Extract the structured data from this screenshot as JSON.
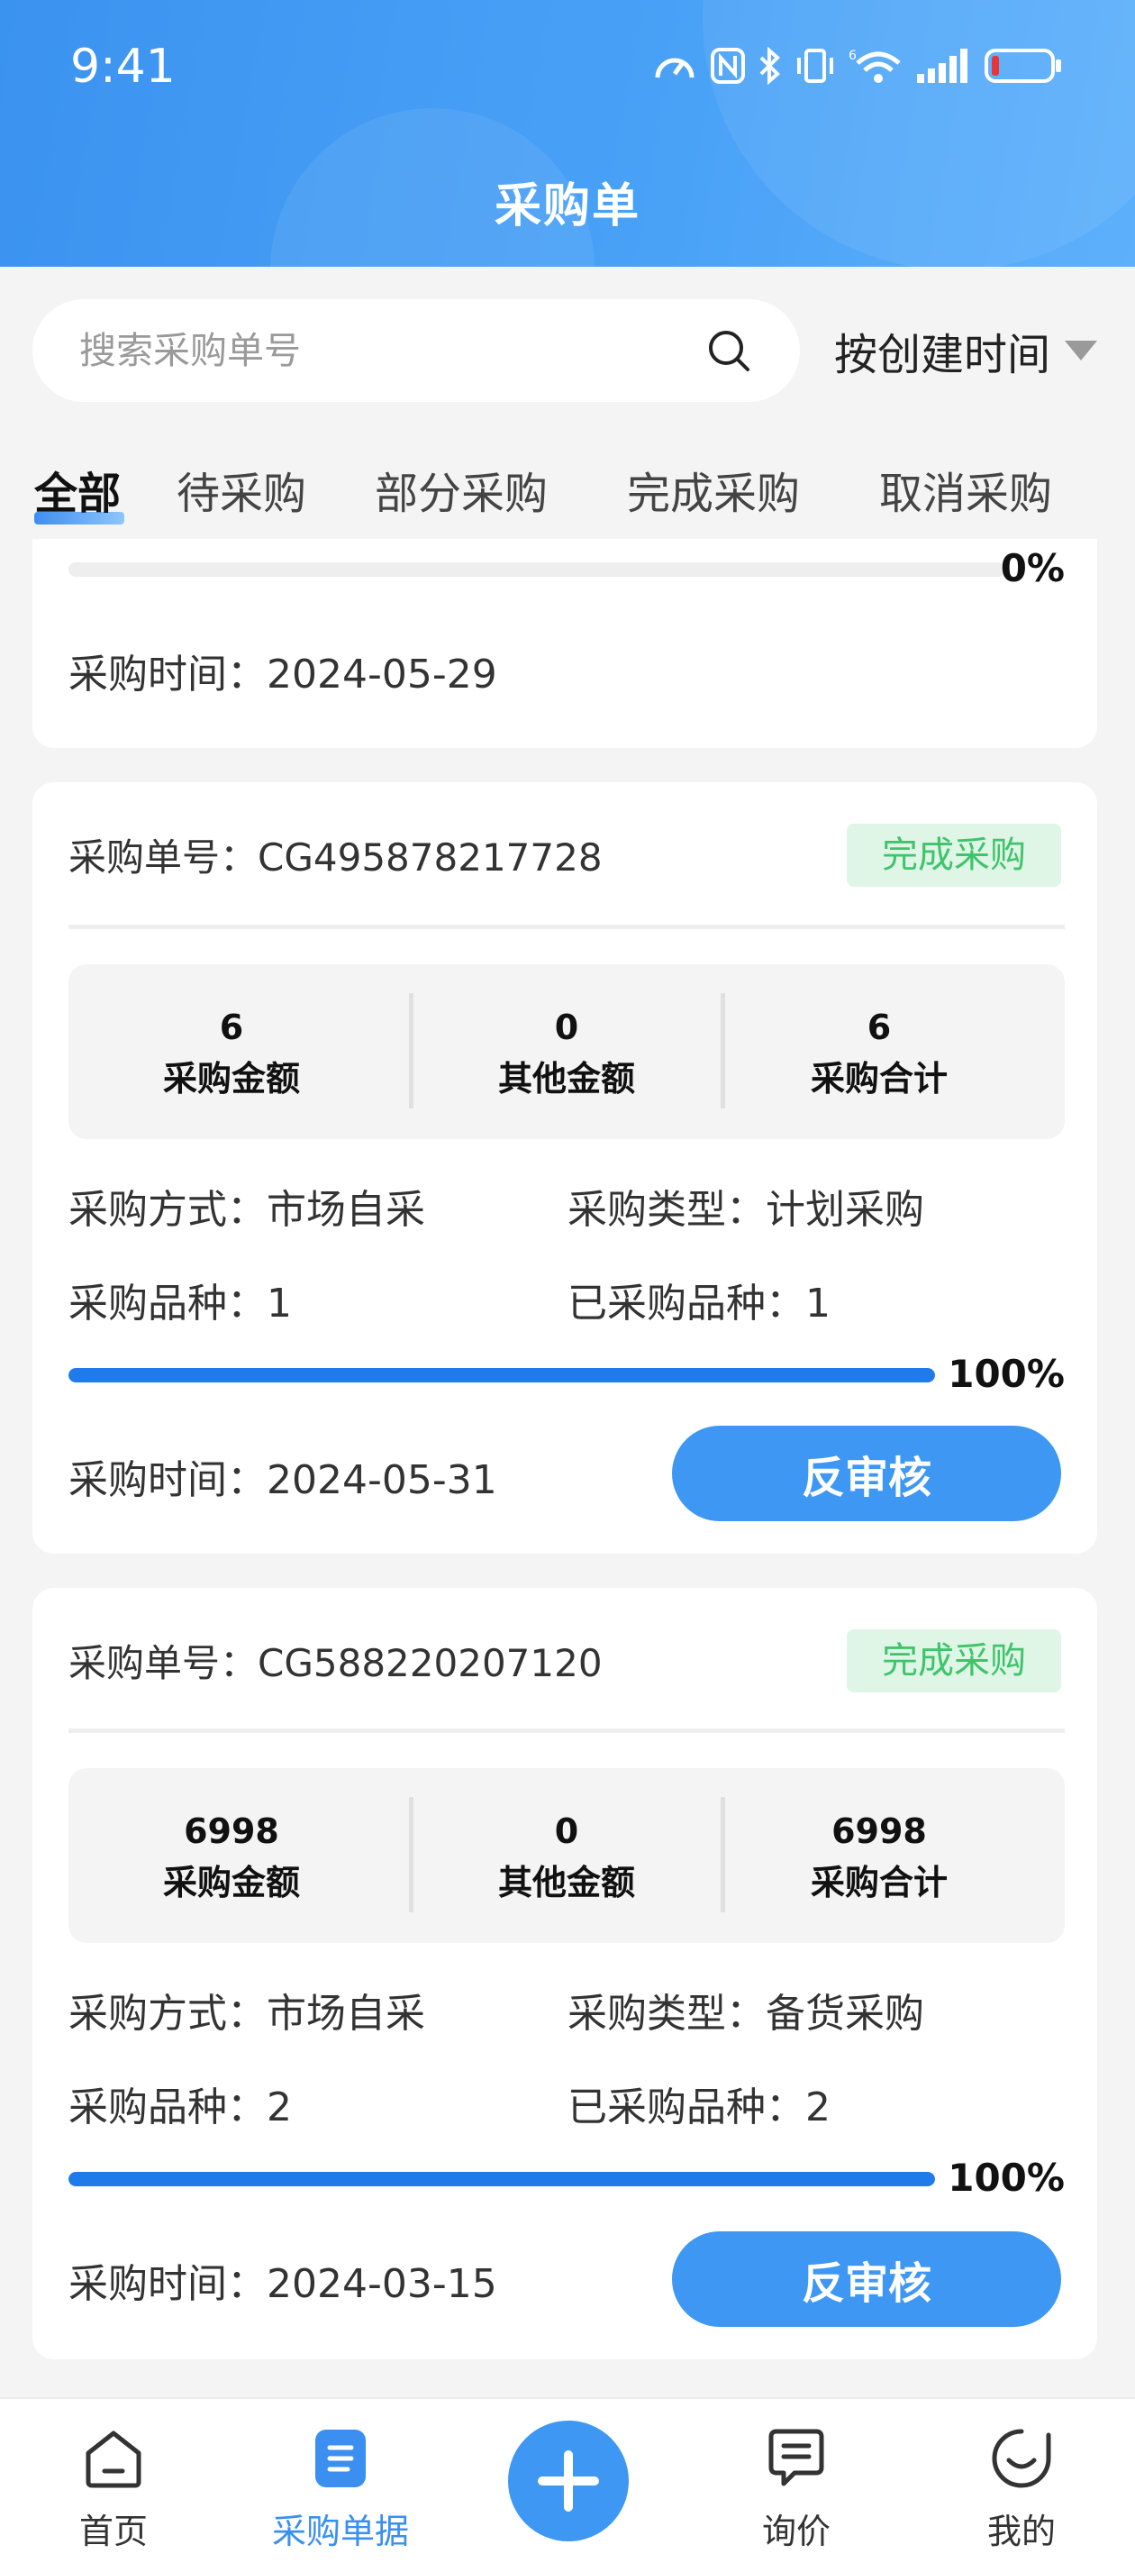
{
  "status_bar": {
    "time": "9:41"
  },
  "header": {
    "title": "采购单"
  },
  "search": {
    "placeholder": "搜索采购单号",
    "value": ""
  },
  "sort": {
    "label": "按创建时间"
  },
  "tabs": [
    {
      "label": "全部"
    },
    {
      "label": "待采购"
    },
    {
      "label": "部分采购"
    },
    {
      "label": "完成采购"
    },
    {
      "label": "取消采购"
    }
  ],
  "partial_card": {
    "percent": "0%",
    "progress": 0,
    "time_label": "采购时间：",
    "time": "2024-05-29"
  },
  "orders": [
    {
      "order_no_label": "采购单号：",
      "order_no": "CG495878217728",
      "status": "完成采购",
      "stats": [
        {
          "value": "6",
          "label": "采购金额"
        },
        {
          "value": "0",
          "label": "其他金额"
        },
        {
          "value": "6",
          "label": "采购合计"
        }
      ],
      "method_label": "采购方式：",
      "method": "市场自采",
      "type_label": "采购类型：",
      "type": "计划采购",
      "varieties_label": "采购品种：",
      "varieties": "1",
      "purchased_label": "已采购品种：",
      "purchased": "1",
      "progress": 100,
      "percent": "100%",
      "time_label": "采购时间：",
      "time": "2024-05-31",
      "action": "反审核"
    },
    {
      "order_no_label": "采购单号：",
      "order_no": "CG588220207120",
      "status": "完成采购",
      "stats": [
        {
          "value": "6998",
          "label": "采购金额"
        },
        {
          "value": "0",
          "label": "其他金额"
        },
        {
          "value": "6998",
          "label": "采购合计"
        }
      ],
      "method_label": "采购方式：",
      "method": "市场自采",
      "type_label": "采购类型：",
      "type": "备货采购",
      "varieties_label": "采购品种：",
      "varieties": "2",
      "purchased_label": "已采购品种：",
      "purchased": "2",
      "progress": 100,
      "percent": "100%",
      "time_label": "采购时间：",
      "time": "2024-03-15",
      "action": "反审核"
    }
  ],
  "bottom_nav": [
    {
      "label": "首页",
      "icon": "home-icon"
    },
    {
      "label": "采购单据",
      "icon": "document-icon"
    },
    {
      "label": "",
      "icon": "plus-icon"
    },
    {
      "label": "询价",
      "icon": "chat-icon"
    },
    {
      "label": "我的",
      "icon": "smile-icon"
    }
  ],
  "colors": {
    "accent": "#3d97f3",
    "status_green": "#3fc46c",
    "status_green_bg": "#dff5e6",
    "progress": "#1f7bea"
  }
}
